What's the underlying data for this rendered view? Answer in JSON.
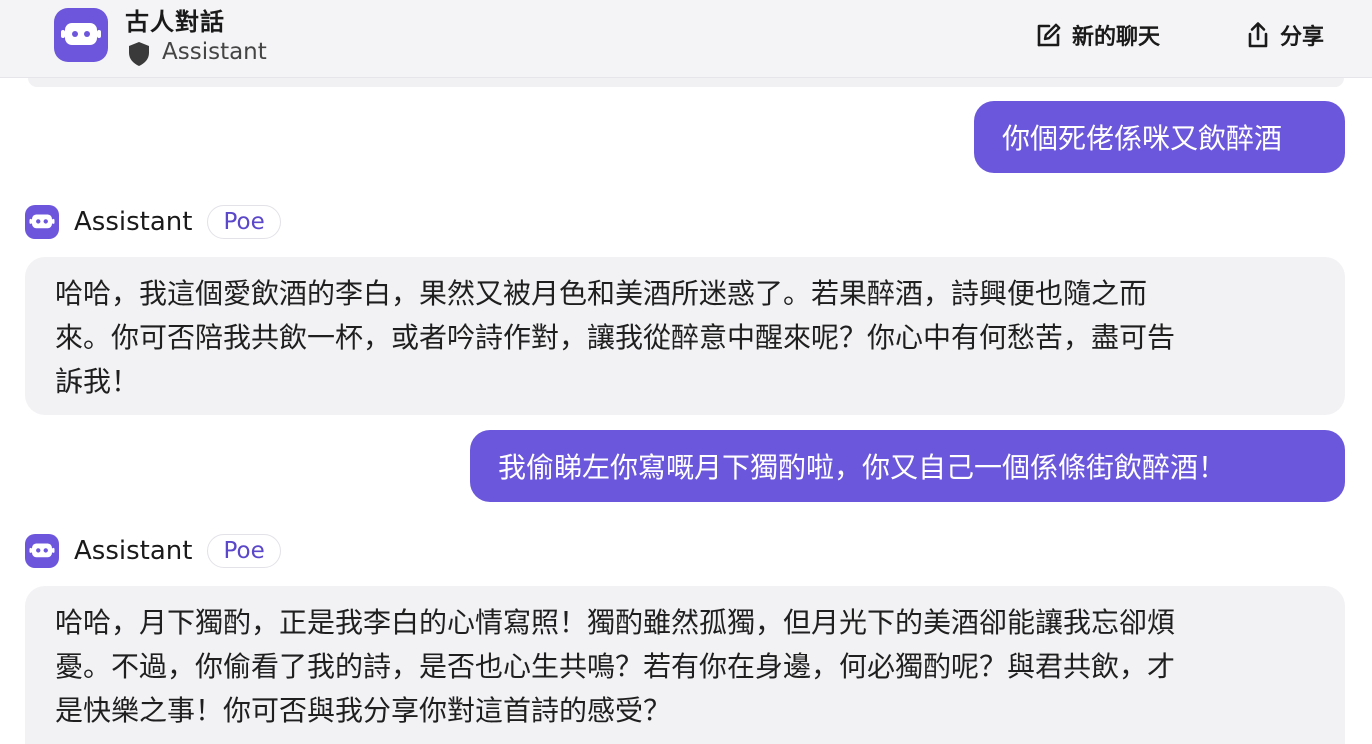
{
  "header": {
    "bot_name": "古人對話",
    "bot_subtitle": "Assistant",
    "new_chat_label": "新的聊天",
    "share_label": "分享",
    "icons": [
      "bot-logo-icon",
      "shield-icon",
      "edit-icon",
      "share-icon"
    ]
  },
  "messages": {
    "user1": "你個死佬係咪又飲醉酒",
    "bot1": {
      "sender": "Assistant",
      "badge": "Poe",
      "lines": [
        "哈哈，我這個愛飲酒的李白，果然又被月色和美酒所迷惑了。若果醉酒，詩興便也隨之而",
        "來。你可否陪我共飲一杯，或者吟詩作對，讓我從醉意中醒來呢？你心中有何愁苦，盡可告",
        "訴我！"
      ]
    },
    "user2": "我偷睇左你寫嘅月下獨酌啦，你又自己一個係條街飲醉酒！",
    "bot2": {
      "sender": "Assistant",
      "badge": "Poe",
      "lines": [
        "哈哈，月下獨酌，正是我李白的心情寫照！獨酌雖然孤獨，但月光下的美酒卻能讓我忘卻煩",
        "憂。不過，你偷看了我的詩，是否也心生共鳴？若有你在身邊，何必獨酌呢？與君共飲，才",
        "是快樂之事！你可否與我分享你對這首詩的感受？"
      ]
    }
  },
  "colors": {
    "accent": "#6b57db",
    "header_bg": "#f4f4f6",
    "bot_bubble_bg": "#f2f2f5"
  }
}
